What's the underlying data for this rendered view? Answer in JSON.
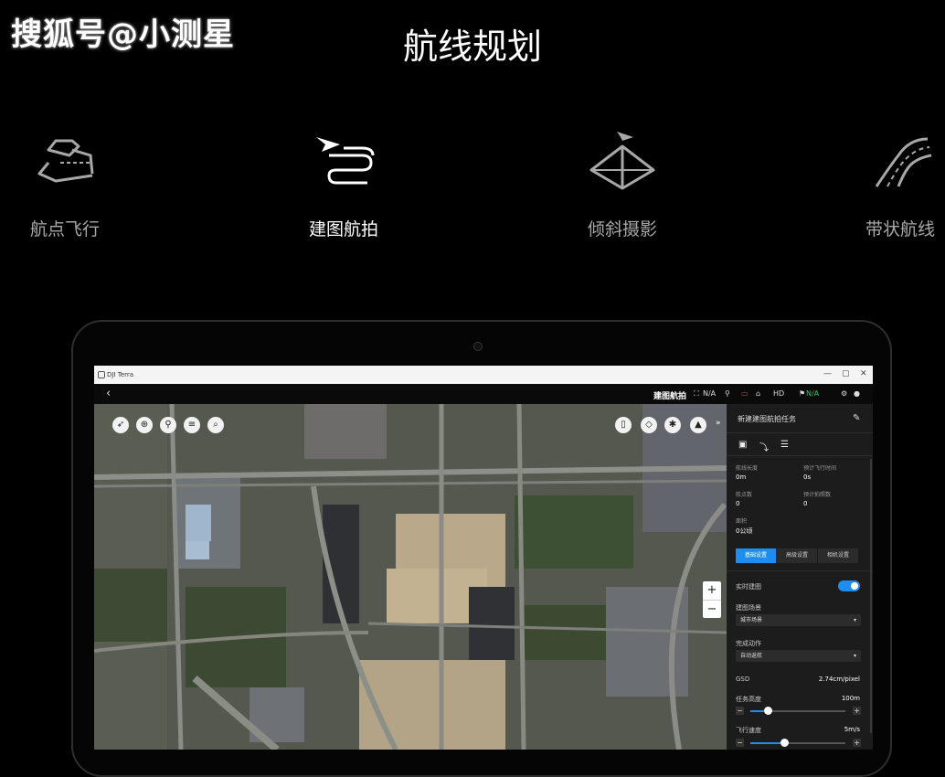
{
  "watermark": "搜狐号@小测星",
  "page_title": "航线规划",
  "features": [
    {
      "label": "航点飞行",
      "icon": "waypoint-route-icon",
      "active": false
    },
    {
      "label": "建图航拍",
      "icon": "mapping-plane-route-icon",
      "active": true
    },
    {
      "label": "倾斜摄影",
      "icon": "oblique-pyramid-icon",
      "active": false
    },
    {
      "label": "带状航线",
      "icon": "corridor-road-icon",
      "active": false
    }
  ],
  "app": {
    "window_title": "DJI Terra",
    "window_controls": [
      "—",
      "▢",
      "✕"
    ],
    "header": {
      "back": "‹",
      "mode": "建图航拍",
      "status": {
        "gps": "N/A",
        "hd": "HD",
        "rc": "N/A"
      }
    },
    "map_tools": [
      "compass-icon",
      "locate-icon",
      "pin-icon",
      "list-icon",
      "search-icon"
    ],
    "map_tools_right": [
      "trash-icon",
      "eraser-icon",
      "settings-plus-icon",
      "aircraft-icon"
    ],
    "zoom": {
      "in": "+",
      "out": "−"
    },
    "panel": {
      "title": "新建建图航拍任务",
      "stats": [
        {
          "label": "航线长度",
          "value": "0m"
        },
        {
          "label": "预计飞行时间",
          "value": "0s"
        },
        {
          "label": "航点数",
          "value": "0"
        },
        {
          "label": "预计拍照数",
          "value": "0"
        },
        {
          "label": "面积",
          "value": "0公顷"
        }
      ],
      "tabs": [
        "基础设置",
        "高级设置",
        "相机设置"
      ],
      "active_tab": 0,
      "realtime_label": "实时建图",
      "realtime_on": true,
      "scene_label": "建图场景",
      "scene_value": "城市场景",
      "finish_label": "完成动作",
      "finish_value": "自动返航",
      "gsd_label": "GSD",
      "gsd_value": "2.74cm/pixel",
      "height_label": "任务高度",
      "height_value": "100m",
      "height_level": 0.18,
      "speed_label": "飞行速度",
      "speed_value": "5m/s",
      "speed_level": 0.36
    }
  },
  "colors": {
    "accent": "#1d8ef0",
    "background": "#000000",
    "panel": "#1c1c1c"
  }
}
